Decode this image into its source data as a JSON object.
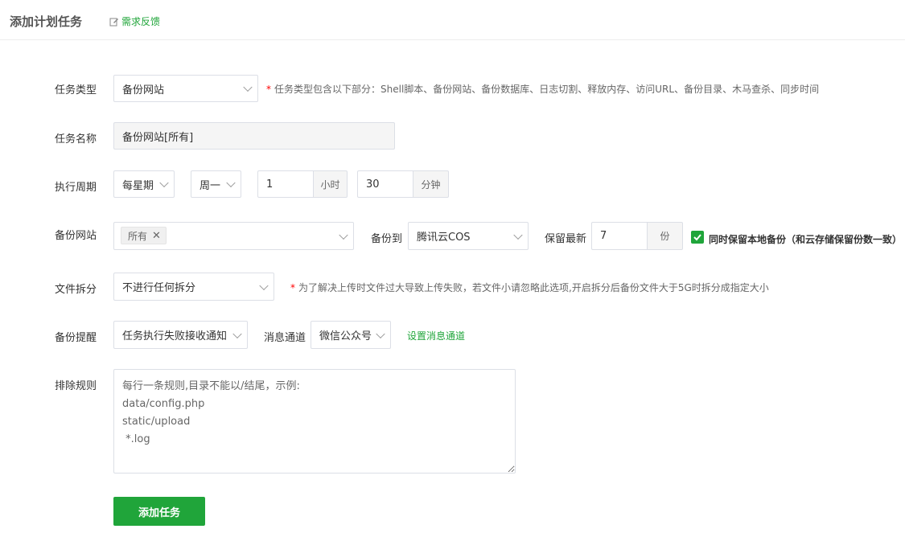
{
  "header": {
    "title": "添加计划任务",
    "feedback_label": "需求反馈"
  },
  "task_type": {
    "label": "任务类型",
    "value": "备份网站",
    "hint": "任务类型包含以下部分：Shell脚本、备份网站、备份数据库、日志切割、释放内存、访问URL、备份目录、木马查杀、同步时间"
  },
  "task_name": {
    "label": "任务名称",
    "value": "备份网站[所有]"
  },
  "period": {
    "label": "执行周期",
    "cycle": "每星期",
    "weekday": "周一",
    "hour": "1",
    "hour_unit": "小时",
    "minute": "30",
    "minute_unit": "分钟"
  },
  "backup_site": {
    "label": "备份网站",
    "tag": "所有",
    "backup_to_label": "备份到",
    "backup_to": "腾讯云COS",
    "keep_label": "保留最新",
    "keep_value": "7",
    "keep_unit": "份",
    "keep_local_label": "同时保留本地备份（和云存储保留份数一致）",
    "keep_local_checked": true
  },
  "split": {
    "label": "文件拆分",
    "value": "不进行任何拆分",
    "hint": "为了解决上传时文件过大导致上传失败，若文件小请忽略此选项,开启拆分后备份文件大于5G时拆分成指定大小"
  },
  "alert": {
    "label": "备份提醒",
    "value": "任务执行失败接收通知",
    "channel_label": "消息通道",
    "channel": "微信公众号",
    "setup_link": "设置消息通道"
  },
  "exclude": {
    "label": "排除规则",
    "placeholder": "每行一条规则,目录不能以/结尾，示例:\ndata/config.php\nstatic/upload\n *.log"
  },
  "submit_label": "添加任务",
  "colors": {
    "accent": "#20a53a",
    "required": "#ff0000"
  }
}
